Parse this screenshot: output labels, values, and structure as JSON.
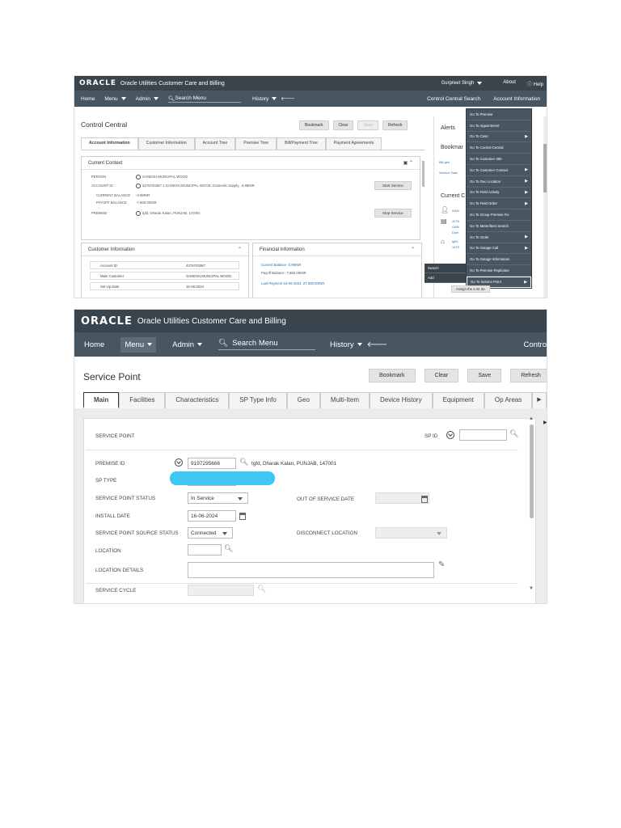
{
  "shot1": {
    "brand": {
      "logo": "ORACLE",
      "product": "Oracle Utilities Customer Care and Billing",
      "user": "Gurpreet Singh",
      "about": "About",
      "help": "Help"
    },
    "nav": {
      "home": "Home",
      "menu": "Menu",
      "admin": "Admin",
      "search": "Search Menu",
      "history": "History",
      "right1": "Control Central Search",
      "right2": "Account Information"
    },
    "title": "Control Central",
    "actions": {
      "bookmark": "Bookmark",
      "clear": "Clear",
      "save": "Save",
      "refresh": "Refresh"
    },
    "tabs": [
      "Account Information",
      "Customer Information",
      "Account Tree",
      "Premise Tree",
      "Bill/Payment Tree",
      "Payment Agreements"
    ],
    "context": {
      "title": "Current Context",
      "person_label": "PERSON",
      "person_value": "GANESH,MUNCIPAL WOOD",
      "account_label": "ACCOUNT ID",
      "account_value": "4276703387 1 GANESH,MUNCIPAL WOOD, Domestic Supply, -3.99INR",
      "balance_label": "CURRENT BALANCE",
      "balance_value": "-3.99INR",
      "payoff_label": "PAYOFF BALANCE",
      "payoff_value": "-7,860.00INR",
      "premise_label": "PREMISE",
      "premise_value": "tgfd, Dharak Kalan, PUNJAB, 147001",
      "start_service": "Start Service",
      "stop_service": "Stop Service"
    },
    "customer_info": {
      "title": "Customer Information",
      "rows": [
        {
          "label": "Account ID",
          "value": "4276703387"
        },
        {
          "label": "Main Customer",
          "value": "GANESH,MUNCIPAL WOOD"
        },
        {
          "label": "Set Up Date",
          "value": "16-06-2024"
        }
      ]
    },
    "financial_info": {
      "title": "Financial Information",
      "current_balance": "Current Balance -3.99INR",
      "payoff_balance": "Payoff Balance -7,860.00INR",
      "last_payment": "Last Payment 16-06-2024, 27,300.00INR"
    },
    "side": {
      "alerts": "Alerts",
      "bookmarks": "Bookmar",
      "link1": "Bill gen",
      "link2": "Service Task",
      "current": "Current C",
      "c1": "GAN",
      "c2": "4276",
      "c3": "GAN",
      "c4": "Dom",
      "c5": "tgfd,",
      "c6": "1470"
    },
    "dropdown": [
      {
        "label": "Go To Premise",
        "arrow": ""
      },
      {
        "label": "Go To Appointment",
        "arrow": ""
      },
      {
        "label": "Go To Case",
        "arrow": "▶"
      },
      {
        "label": "Go To Control Central",
        "arrow": ""
      },
      {
        "label": "Go To Customer 360",
        "arrow": ""
      },
      {
        "label": "Go To Customer Contact",
        "arrow": "▶"
      },
      {
        "label": "Go To Geo Location",
        "arrow": "▶"
      },
      {
        "label": "Go To Field Activity",
        "arrow": "▶"
      },
      {
        "label": "Go To Field Order",
        "arrow": "▶"
      },
      {
        "label": "Go To Group Premise Fis",
        "arrow": ""
      },
      {
        "label": "Go To Meter/Item Search",
        "arrow": ""
      },
      {
        "label": "Go To Order",
        "arrow": "▶"
      },
      {
        "label": "Go To Outage Call",
        "arrow": "▶"
      },
      {
        "label": "Go To Outage Information",
        "arrow": ""
      },
      {
        "label": "Go To Premise Replicator",
        "arrow": ""
      },
      {
        "label": "Go To Service Point",
        "arrow": "▶"
      }
    ],
    "submenu": {
      "search": "Search",
      "add": "Add"
    },
    "tiny_button": "Assign the a Ist Se"
  },
  "shot2": {
    "brand": {
      "logo": "ORACLE",
      "product": "Oracle Utilities Customer Care and Billing"
    },
    "nav": {
      "home": "Home",
      "menu": "Menu",
      "admin": "Admin",
      "search": "Search Menu",
      "history": "History",
      "right": "Contro"
    },
    "title": "Service Point",
    "actions": {
      "bookmark": "Bookmark",
      "clear": "Clear",
      "save": "Save",
      "refresh": "Refresh"
    },
    "tabs": [
      "Main",
      "Facilities",
      "Characteristics",
      "SP Type Info",
      "Geo",
      "Multi-Item",
      "Device History",
      "Equipment",
      "Op Areas"
    ],
    "form": {
      "service_point_label": "SERVICE POINT",
      "sp_id_label": "SP ID",
      "premise_id_label": "PREMISE ID",
      "premise_id_value": "9197295666",
      "premise_desc": "tgfd, Dharak Kalan, PUNJAB, 147001",
      "sp_type_label": "SP TYPE",
      "status_label": "SERVICE POINT STATUS",
      "status_value": "In Service",
      "out_of_service_label": "OUT OF SERVICE DATE",
      "install_date_label": "INSTALL DATE",
      "install_date_value": "16-06-2024",
      "source_status_label": "SERVICE POINT SOURCE STATUS",
      "source_status_value": "Connected",
      "disconnect_label": "DISCONNECT LOCATION",
      "location_label": "LOCATION",
      "location_details_label": "LOCATION DETAILS",
      "service_cycle_label": "SERVICE CYCLE"
    }
  }
}
